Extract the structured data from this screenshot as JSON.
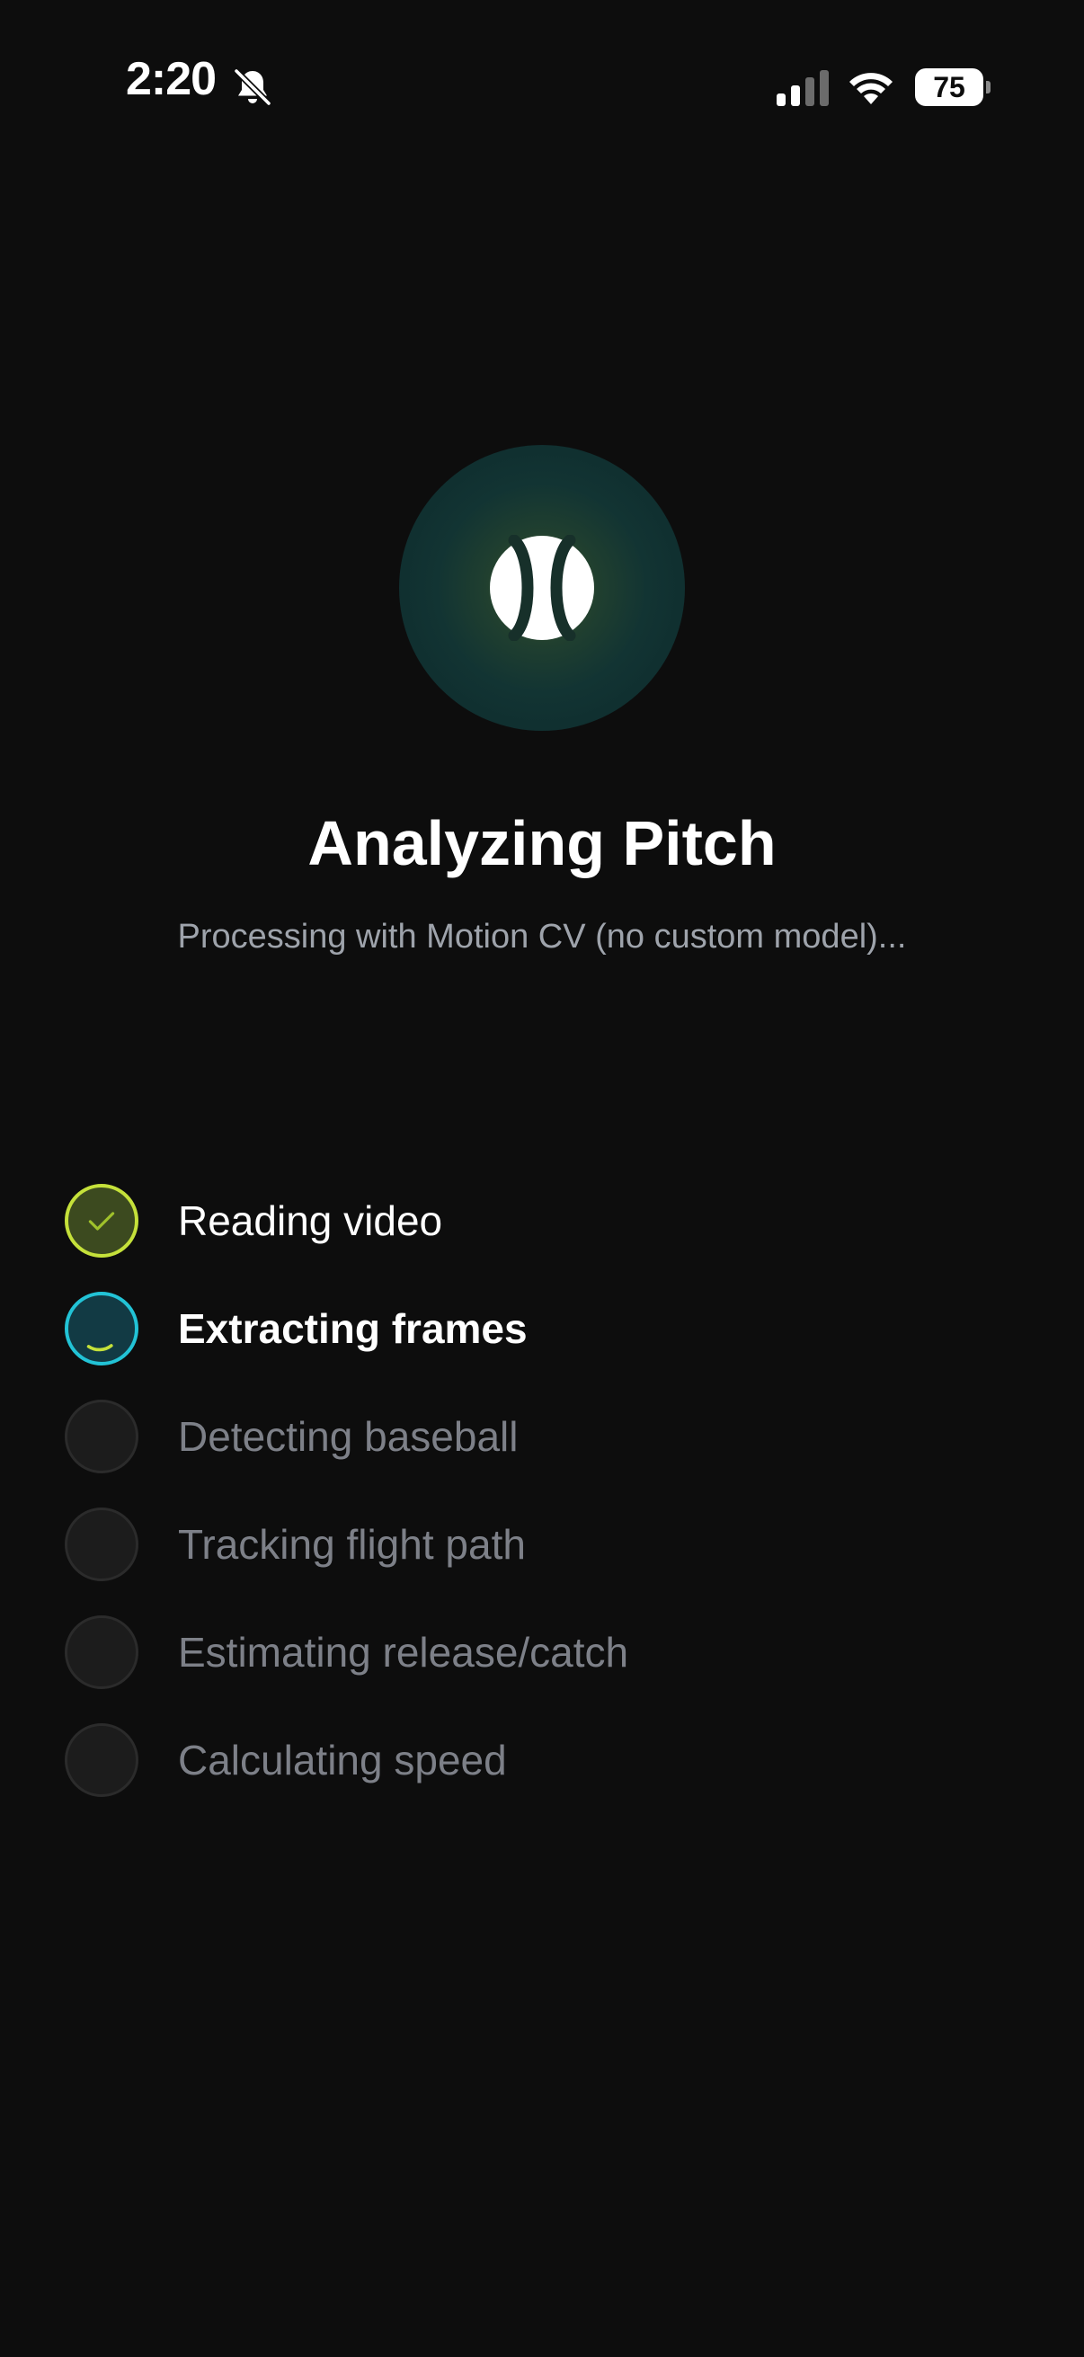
{
  "status_bar": {
    "time": "2:20",
    "battery": "75"
  },
  "hero": {
    "icon": "baseball-icon",
    "title": "Analyzing Pitch",
    "subtitle": "Processing with Motion CV (no custom model)..."
  },
  "steps": [
    {
      "label": "Reading video",
      "state": "done"
    },
    {
      "label": "Extracting frames",
      "state": "active"
    },
    {
      "label": "Detecting baseball",
      "state": "pending"
    },
    {
      "label": "Tracking flight path",
      "state": "pending"
    },
    {
      "label": "Estimating release/catch",
      "state": "pending"
    },
    {
      "label": "Calculating speed",
      "state": "pending"
    }
  ],
  "colors": {
    "background": "#0d0d0d",
    "done_accent": "#c5e13a",
    "active_accent": "#22c3d6",
    "pending_text": "#7d8088",
    "subtitle_text": "#9ea3ab"
  }
}
